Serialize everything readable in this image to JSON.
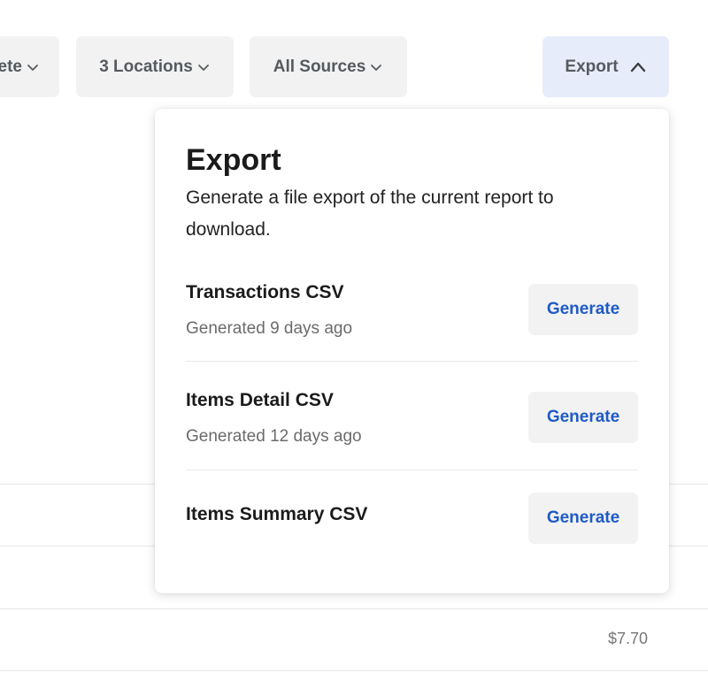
{
  "filters": {
    "partial_label": "ete",
    "locations_label": "3 Locations",
    "sources_label": "All Sources",
    "export_label": "Export"
  },
  "table": {
    "visible_value": "$7.70"
  },
  "export_panel": {
    "title": "Export",
    "description": "Generate a file export of the current report to download.",
    "items": [
      {
        "title": "Transactions CSV",
        "meta": "Generated 9 days ago",
        "button": "Generate"
      },
      {
        "title": "Items Detail CSV",
        "meta": "Generated 12 days ago",
        "button": "Generate"
      },
      {
        "title": "Items Summary CSV",
        "meta": "",
        "button": "Generate"
      }
    ]
  },
  "colors": {
    "accent_text": "#1f5bc6",
    "export_active_bg": "#e7ecfb",
    "button_bg": "#f2f2f2"
  },
  "icons": {
    "filter_chevron": "chevron-down-icon",
    "export_chevron": "chevron-up-icon"
  }
}
